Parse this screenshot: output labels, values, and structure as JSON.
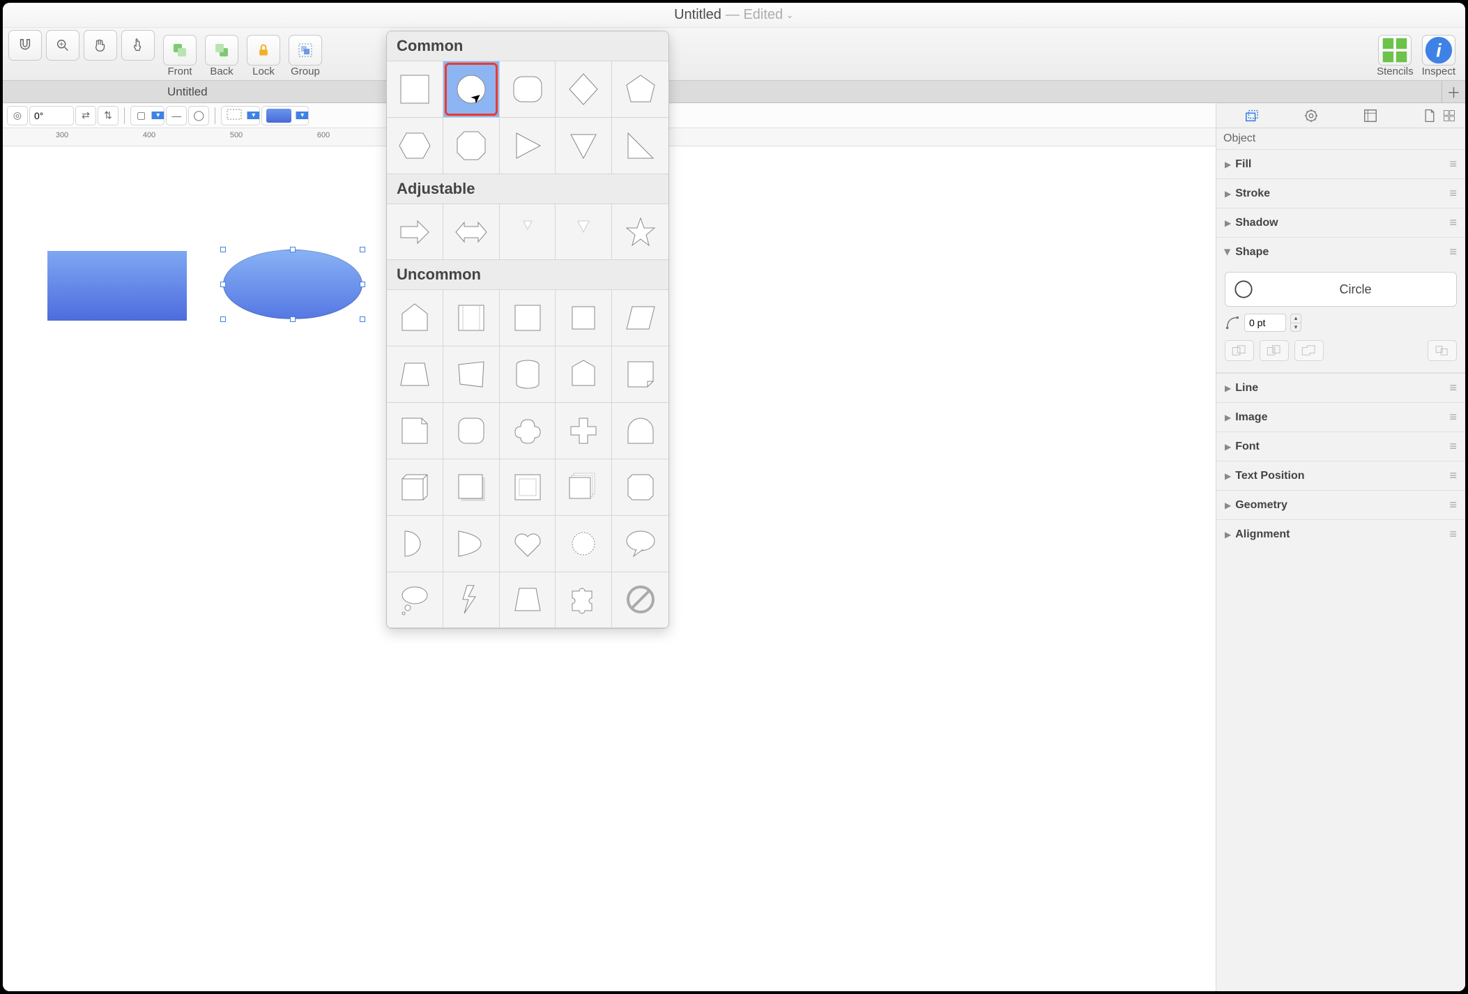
{
  "title": {
    "name": "Untitled",
    "edited": "— Edited"
  },
  "toolbar": {
    "front": "Front",
    "back": "Back",
    "lock": "Lock",
    "group": "Group",
    "stencils": "Stencils",
    "inspect": "Inspect"
  },
  "tab": "Untitled",
  "format": {
    "rotation": "0°"
  },
  "ruler_ticks": [
    "300",
    "400",
    "500",
    "600"
  ],
  "popover": {
    "sections": {
      "common": "Common",
      "adjustable": "Adjustable",
      "uncommon": "Uncommon"
    },
    "common": [
      "square",
      "circle",
      "rounded-rect",
      "diamond",
      "pentagon",
      "hexagon",
      "octagon",
      "triangle-right",
      "triangle-down",
      "right-triangle"
    ],
    "adjustable": [
      "arrow-right",
      "arrow-both",
      "angle-small",
      "angle-down",
      "star"
    ],
    "uncommon": [
      "house",
      "rect-inset",
      "square-plain",
      "square-small",
      "parallelogram",
      "trapezoid",
      "quad",
      "cylinder",
      "poly5",
      "note",
      "page",
      "rounded-square",
      "cloud",
      "plus",
      "arch",
      "box3d",
      "square-shadow",
      "bevel",
      "stack",
      "oct2",
      "dshape",
      "dshape2",
      "heart",
      "burst",
      "speech",
      "thought",
      "lightning",
      "trap2",
      "puzzle",
      "nosign"
    ],
    "selected": "circle"
  },
  "inspector": {
    "object": "Object",
    "sections": {
      "fill": "Fill",
      "stroke": "Stroke",
      "shadow": "Shadow",
      "shape": "Shape",
      "line": "Line",
      "image": "Image",
      "font": "Font",
      "textpos": "Text Position",
      "geometry": "Geometry",
      "alignment": "Alignment"
    },
    "shape_name": "Circle",
    "corner_pt": "0 pt"
  }
}
